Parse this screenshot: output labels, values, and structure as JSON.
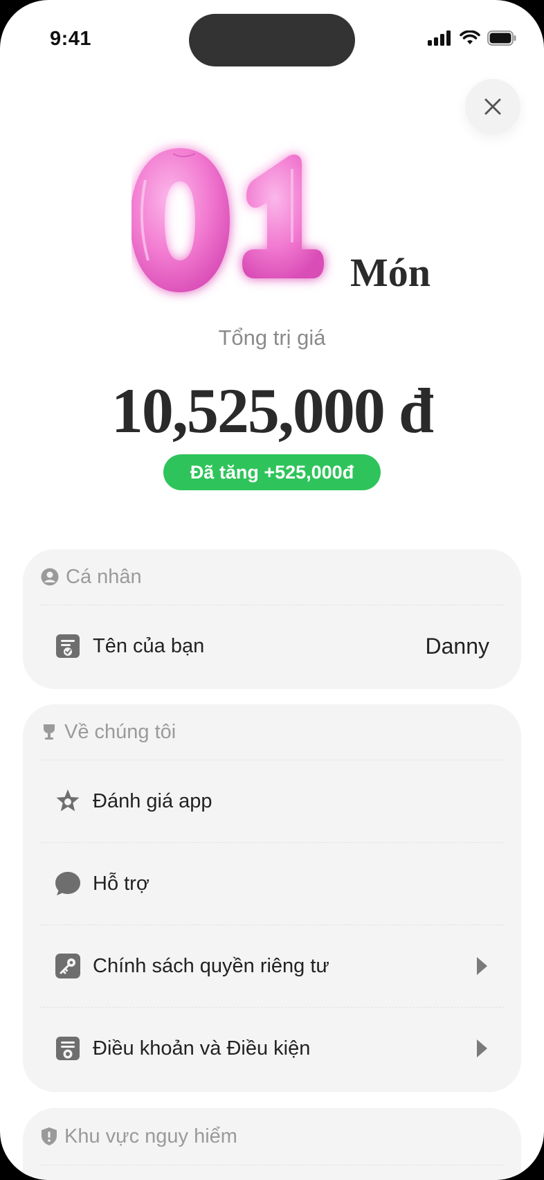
{
  "status": {
    "time": "9:41"
  },
  "hero": {
    "number": "01",
    "unit": "Món"
  },
  "summary": {
    "total_label": "Tổng trị giá",
    "total_value": "10,525,000 đ",
    "gain_badge": "Đã tăng +525,000đ"
  },
  "colors": {
    "accent_green": "#2fc45b",
    "balloon_pink": "#f27bd1",
    "card_bg": "#f4f4f4"
  },
  "personal": {
    "header": "Cá nhân",
    "rows": [
      {
        "label": "Tên của bạn",
        "value": "Danny",
        "icon": "name-card-icon"
      }
    ]
  },
  "about": {
    "header": "Về chúng tôi",
    "rows": [
      {
        "label": "Đánh giá app",
        "icon": "star-badge-icon"
      },
      {
        "label": "Hỗ trợ",
        "icon": "chat-bubble-icon"
      },
      {
        "label": "Chính sách quyền riêng tư",
        "icon": "key-icon"
      },
      {
        "label": "Điều khoản và Điều kiện",
        "icon": "certificate-icon"
      }
    ]
  },
  "danger": {
    "header": "Khu vực nguy hiểm"
  }
}
